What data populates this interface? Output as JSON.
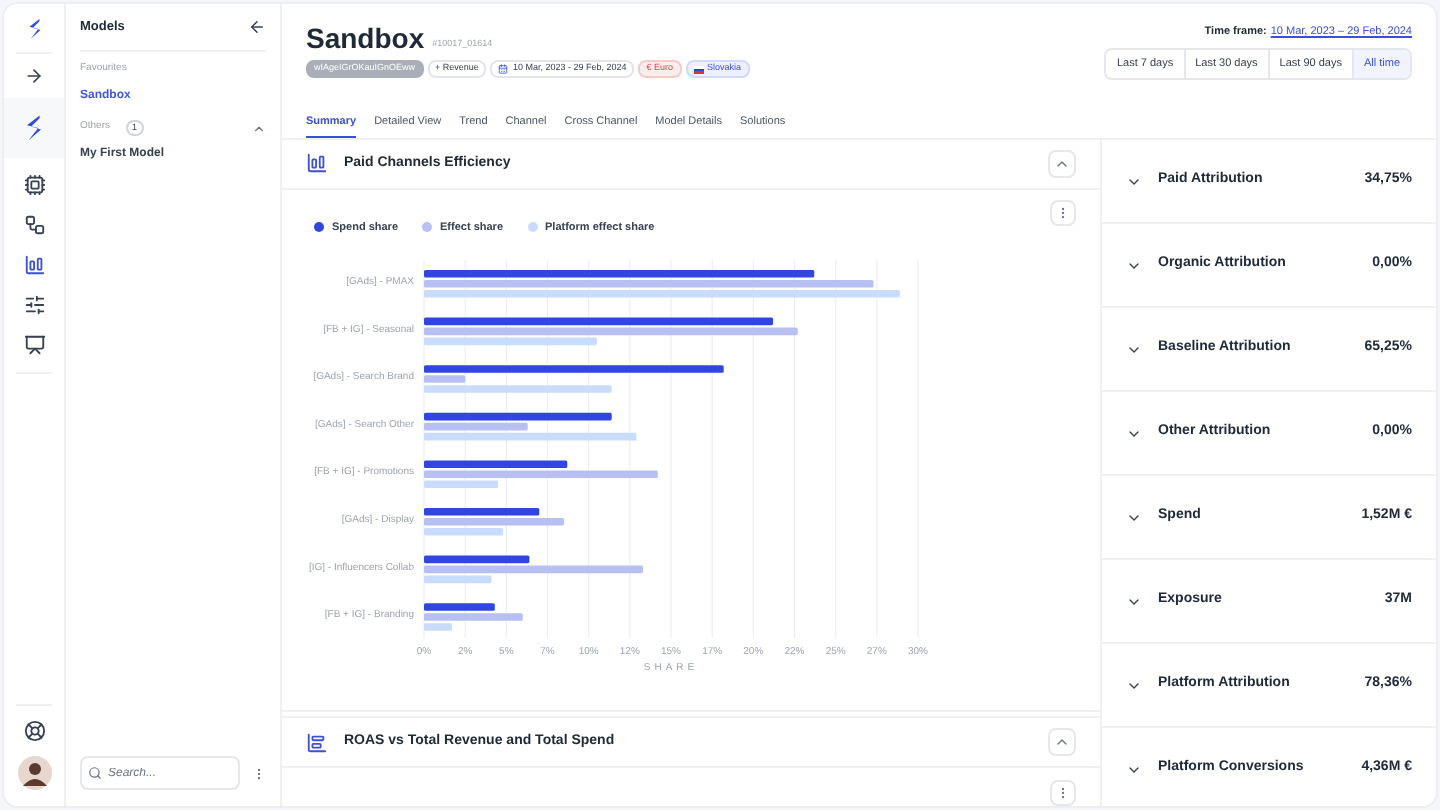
{
  "sidebar": {
    "title": "Models",
    "sections": [
      {
        "label": "Favourites",
        "items": [
          {
            "label": "Sandbox",
            "selected": true
          }
        ]
      },
      {
        "label": "Others",
        "count": "1",
        "expanded": true,
        "items": [
          {
            "label": "My First Model",
            "selected": false
          }
        ]
      }
    ],
    "search": {
      "placeholder": "Search..."
    }
  },
  "rail": {
    "items": [
      {
        "kind": "cpu",
        "selected": false
      },
      {
        "kind": "flow",
        "selected": false
      },
      {
        "kind": "chart",
        "selected": true
      },
      {
        "kind": "sliders",
        "selected": false
      },
      {
        "kind": "board",
        "selected": false
      }
    ]
  },
  "header": {
    "title": "Sandbox",
    "id": "#10017_01614",
    "chips": [
      {
        "kind": "key",
        "label": "wIAgeIGrOKauIGnOEww"
      },
      {
        "kind": "metric",
        "label": "+ Revenue"
      },
      {
        "kind": "date",
        "label": "10 Mar, 2023 - 29 Feb, 2024"
      },
      {
        "kind": "currency",
        "label": "€ Euro"
      },
      {
        "kind": "country",
        "label": "Slovakia"
      }
    ],
    "time_frame": {
      "label": "Time frame:",
      "value": "10 Mar, 2023 – 29 Feb, 2024"
    },
    "ranges": [
      {
        "label": "Last 7 days",
        "selected": false
      },
      {
        "label": "Last 30 days",
        "selected": false
      },
      {
        "label": "Last 90 days",
        "selected": false
      },
      {
        "label": "All time",
        "selected": true
      }
    ]
  },
  "tabs": [
    {
      "label": "Summary",
      "selected": true
    },
    {
      "label": "Detailed View",
      "selected": false
    },
    {
      "label": "Trend",
      "selected": false
    },
    {
      "label": "Channel",
      "selected": false
    },
    {
      "label": "Cross Channel",
      "selected": false
    },
    {
      "label": "Model Details",
      "selected": false
    },
    {
      "label": "Solutions",
      "selected": false
    }
  ],
  "cards": [
    {
      "title": "Paid Channels Efficiency",
      "expanded": true,
      "chart_data": {
        "type": "bar",
        "orientation": "horizontal",
        "grid": true,
        "legend": true,
        "xlabel": "SHARE",
        "categories": [
          "[GAds] - PMAX",
          "[FB + IG] - Seasonal",
          "[GAds] - Search Brand",
          "[GAds] - Search Other",
          "[FB + IG] - Promotions",
          "[GAds] - Display",
          "[IG] - Influencers Collab",
          "[FB + IG] - Branding"
        ],
        "series": [
          {
            "name": "Spend share",
            "color": "#3146e0",
            "values": [
              23.7,
              21.2,
              18.2,
              11.4,
              8.7,
              7.0,
              6.4,
              4.3
            ]
          },
          {
            "name": "Effect share",
            "color": "#b8c0f3",
            "values": [
              27.3,
              22.7,
              2.5,
              6.3,
              14.2,
              8.5,
              13.3,
              6.0
            ]
          },
          {
            "name": "Platform effect share",
            "color": "#c9dcfb",
            "values": [
              28.9,
              10.5,
              11.4,
              12.9,
              4.5,
              4.8,
              4.1,
              1.7
            ]
          }
        ],
        "xlim": [
          0,
          30
        ],
        "xticks": [
          {
            "value": 0,
            "label": "0%"
          },
          {
            "value": 2.5,
            "label": "2%"
          },
          {
            "value": 5,
            "label": "5%"
          },
          {
            "value": 7.5,
            "label": "7%"
          },
          {
            "value": 10,
            "label": "10%"
          },
          {
            "value": 12.5,
            "label": "12%"
          },
          {
            "value": 15,
            "label": "15%"
          },
          {
            "value": 17.5,
            "label": "17%"
          },
          {
            "value": 20,
            "label": "20%"
          },
          {
            "value": 22.5,
            "label": "22%"
          },
          {
            "value": 25,
            "label": "25%"
          },
          {
            "value": 27.5,
            "label": "27%"
          },
          {
            "value": 30,
            "label": "30%"
          }
        ]
      }
    },
    {
      "title": "ROAS vs Total Revenue and Total Spend",
      "expanded": true
    }
  ],
  "metrics": [
    {
      "label": "Paid Attribution",
      "value": "34,75%"
    },
    {
      "label": "Organic Attribution",
      "value": "0,00%"
    },
    {
      "label": "Baseline Attribution",
      "value": "65,25%"
    },
    {
      "label": "Other Attribution",
      "value": "0,00%"
    },
    {
      "label": "Spend",
      "value": "1,52M €"
    },
    {
      "label": "Exposure",
      "value": "37M"
    },
    {
      "label": "Platform Attribution",
      "value": "78,36%"
    },
    {
      "label": "Platform Conversions",
      "value": "4,36M €"
    }
  ]
}
